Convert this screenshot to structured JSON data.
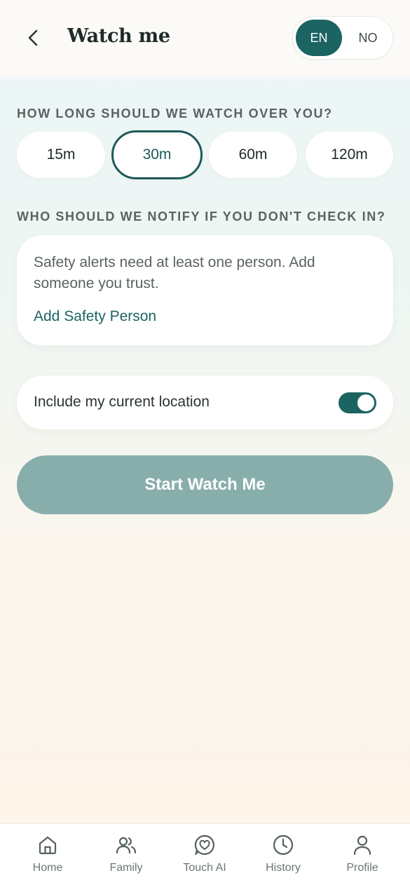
{
  "header": {
    "title": "Watch me",
    "lang": {
      "selected": "EN",
      "options": [
        "EN",
        "NO"
      ]
    }
  },
  "duration": {
    "label": "HOW LONG SHOULD WE WATCH OVER YOU?",
    "options": [
      "15m",
      "30m",
      "60m",
      "120m"
    ],
    "selected": "30m"
  },
  "notify": {
    "label": "WHO SHOULD WE NOTIFY IF YOU DON'T CHECK IN?",
    "message": "Safety alerts need at least one person. Add someone you trust.",
    "add_link": "Add Safety Person"
  },
  "location": {
    "label": "Include my current location",
    "enabled": true
  },
  "start_button": "Start Watch Me",
  "tabbar": [
    {
      "label": "Home",
      "icon": "home-icon"
    },
    {
      "label": "Family",
      "icon": "family-icon"
    },
    {
      "label": "Touch AI",
      "icon": "chat-heart-icon"
    },
    {
      "label": "History",
      "icon": "clock-icon"
    },
    {
      "label": "Profile",
      "icon": "user-icon"
    }
  ],
  "colors": {
    "accent": "#1b6462",
    "button_disabled": "#88aeac"
  }
}
